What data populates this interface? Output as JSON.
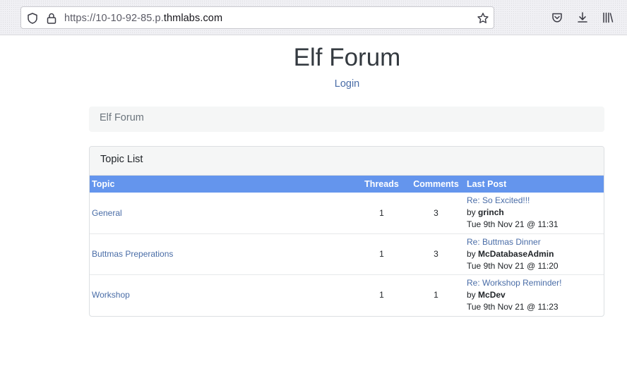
{
  "browser": {
    "url_prefix": "https://10-10-92-85.p.",
    "url_domain": "thmlabs.com",
    "icons": [
      "shield-icon",
      "lock-icon",
      "star-icon",
      "pocket-icon",
      "download-icon",
      "library-icon"
    ]
  },
  "site": {
    "title": "Elf Forum",
    "login_label": "Login"
  },
  "breadcrumb": {
    "label": "Elf Forum"
  },
  "topic_list": {
    "header": "Topic List",
    "columns": {
      "topic": "Topic",
      "threads": "Threads",
      "comments": "Comments",
      "last_post": "Last Post"
    },
    "rows": [
      {
        "topic": "General",
        "threads": "1",
        "comments": "3",
        "last_post_title": "Re: So Excited!!!",
        "by_label": "by",
        "last_post_user": "grinch",
        "last_post_date": "Tue 9th Nov 21 @ 11:31"
      },
      {
        "topic": "Buttmas Preperations",
        "threads": "1",
        "comments": "3",
        "last_post_title": "Re: Buttmas Dinner",
        "by_label": "by",
        "last_post_user": "McDatabaseAdmin",
        "last_post_date": "Tue 9th Nov 21 @ 11:20"
      },
      {
        "topic": "Workshop",
        "threads": "1",
        "comments": "1",
        "last_post_title": "Re: Workshop Reminder!",
        "by_label": "by",
        "last_post_user": "McDev",
        "last_post_date": "Tue 9th Nov 21 @ 11:23"
      }
    ]
  },
  "colors": {
    "table_header": "#6495ed",
    "link": "#4a6da7",
    "breadcrumb_bg": "#f5f6f6"
  }
}
